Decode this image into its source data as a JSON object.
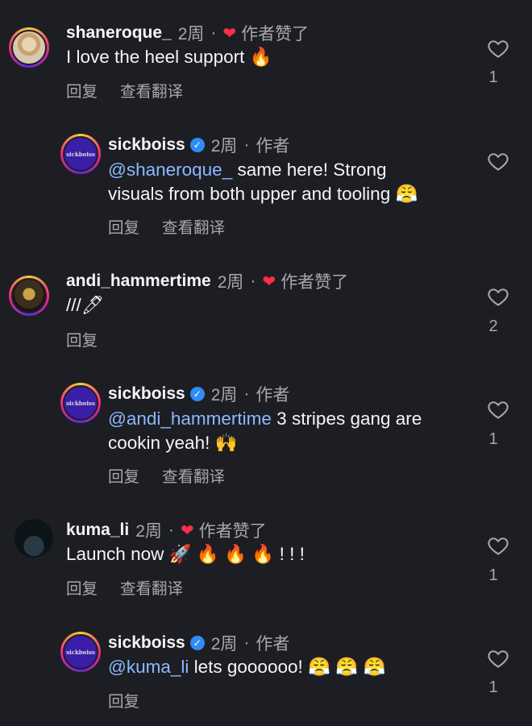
{
  "comments": [
    {
      "username": "shaneroque_",
      "time": "2周",
      "liked_label": "作者赞了",
      "text": "I love the heel support 🔥",
      "reply_label": "回复",
      "translate_label": "查看翻译",
      "like_count": "1"
    },
    {
      "username": "sickboiss",
      "time": "2周",
      "author_label": "作者",
      "avatar_text": "sickboiss",
      "mention": "@shaneroque_",
      "text_line1": " same here! Strong",
      "text_line2": "visuals from both upper and tooling 😤",
      "reply_label": "回复",
      "translate_label": "查看翻译"
    },
    {
      "username": "andi_hammertime",
      "time": "2周",
      "liked_label": "作者赞了",
      "text": "///🖊",
      "reply_label": "回复",
      "like_count": "2"
    },
    {
      "username": "sickboiss",
      "time": "2周",
      "author_label": "作者",
      "avatar_text": "sickboiss",
      "mention": "@andi_hammertime",
      "text_line1": " 3 stripes gang are",
      "text_line2": "cookin yeah! 🙌",
      "reply_label": "回复",
      "translate_label": "查看翻译",
      "like_count": "1"
    },
    {
      "username": "kuma_li",
      "time": "2周",
      "liked_label": "作者赞了",
      "text": "Launch now 🚀 🔥 🔥 🔥 ! ! !",
      "reply_label": "回复",
      "translate_label": "查看翻译",
      "like_count": "1"
    },
    {
      "username": "sickboiss",
      "time": "2周",
      "author_label": "作者",
      "avatar_text": "sickboiss",
      "mention": "@kuma_li",
      "text_line1": " lets goooooo! 😤 😤 😤",
      "reply_label": "回复",
      "like_count": "1"
    }
  ],
  "colors": {
    "background": "#1c1e24",
    "mention": "#8db8ff",
    "heart": "#ff2d48",
    "verified": "#2f8cf5"
  },
  "icons": [
    "heart-outline-icon",
    "heart-filled-icon",
    "verified-badge-icon"
  ]
}
